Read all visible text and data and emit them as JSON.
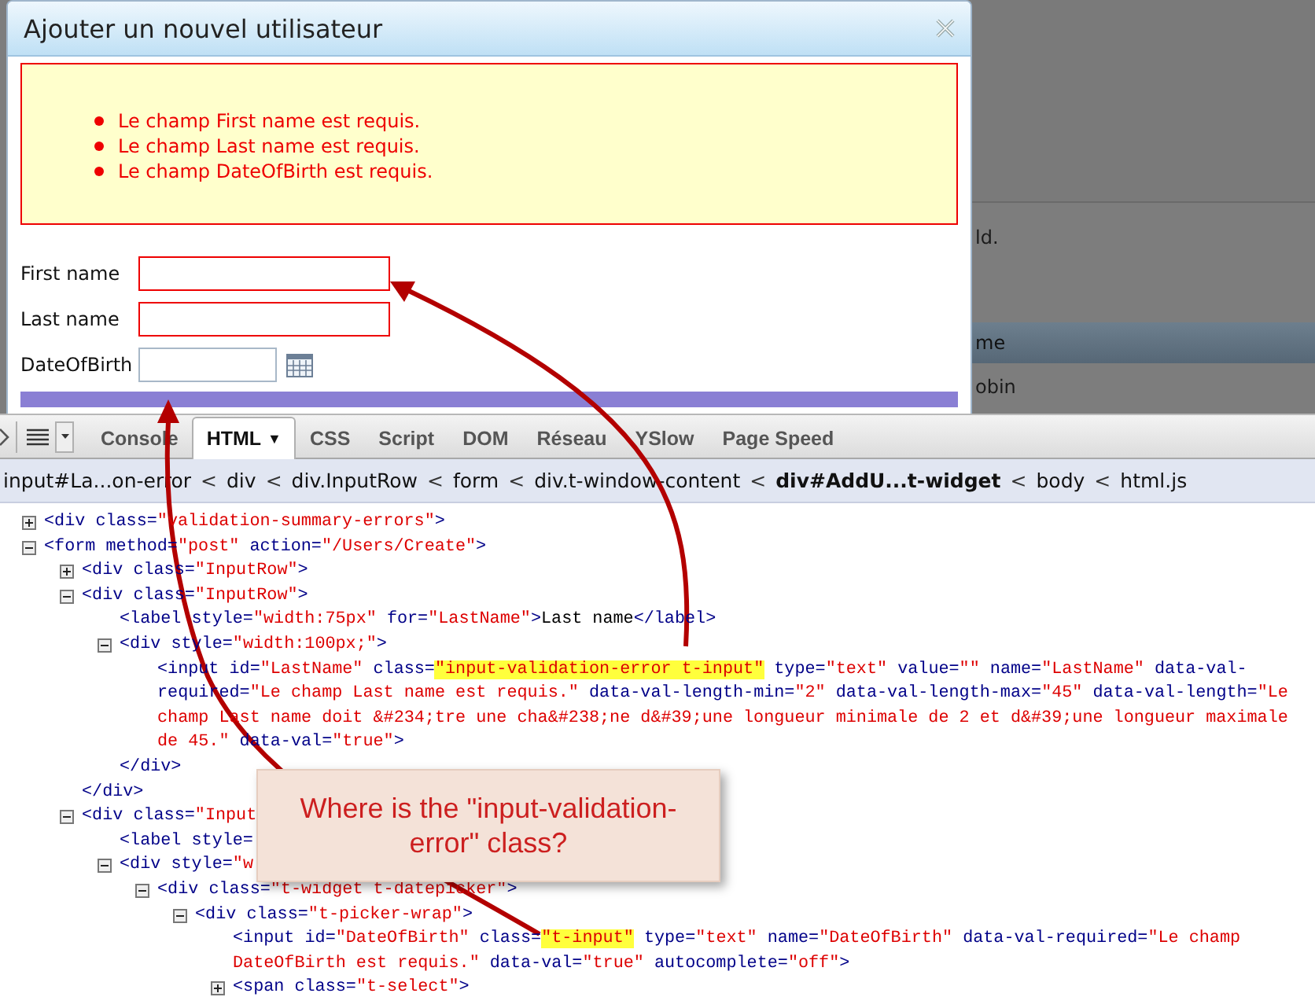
{
  "dialog": {
    "title": "Ajouter un nouvel utilisateur",
    "errors": [
      "Le champ First name est requis.",
      "Le champ Last name est requis.",
      "Le champ DateOfBirth est requis."
    ],
    "fields": [
      {
        "label": "First name",
        "kind": "text",
        "error": true
      },
      {
        "label": "Last name",
        "kind": "text",
        "error": true
      },
      {
        "label": "DateOfBirth",
        "kind": "date",
        "error": false
      }
    ]
  },
  "background_page": {
    "note": "ld.",
    "table_header": "me",
    "table_cell": "obin"
  },
  "firebug": {
    "tabs": [
      {
        "label": "Console",
        "selected": false
      },
      {
        "label": "HTML",
        "selected": true,
        "glyph": "▼"
      },
      {
        "label": "CSS",
        "selected": false
      },
      {
        "label": "Script",
        "selected": false
      },
      {
        "label": "DOM",
        "selected": false
      },
      {
        "label": "Réseau",
        "selected": false
      },
      {
        "label": "YSlow",
        "selected": false
      },
      {
        "label": "Page Speed",
        "selected": false
      }
    ],
    "breadcrumb": [
      {
        "kind": "crumb",
        "label": "input#La...on-error",
        "selected": false
      },
      {
        "kind": "separator",
        "label": "<"
      },
      {
        "kind": "crumb",
        "label": "div",
        "selected": false
      },
      {
        "kind": "separator",
        "label": "<"
      },
      {
        "kind": "crumb",
        "label": "div.InputRow",
        "selected": false
      },
      {
        "kind": "separator",
        "label": "<"
      },
      {
        "kind": "crumb",
        "label": "form",
        "selected": false
      },
      {
        "kind": "separator",
        "label": "<"
      },
      {
        "kind": "crumb",
        "label": "div.t-window-content",
        "selected": false
      },
      {
        "kind": "separator",
        "label": "<"
      },
      {
        "kind": "crumb",
        "label": "div#AddU...t-widget",
        "selected": true
      },
      {
        "kind": "separator",
        "label": "<"
      },
      {
        "kind": "crumb",
        "label": "body",
        "selected": false
      },
      {
        "kind": "separator",
        "label": "<"
      },
      {
        "kind": "crumb",
        "label": "html.js",
        "selected": false
      }
    ]
  },
  "html_tree": [
    {
      "kind": "element",
      "expanded": false,
      "segments": [
        {
          "kind": "tag",
          "text": "<div "
        },
        {
          "kind": "attr",
          "text": "class="
        },
        {
          "kind": "value",
          "text": "\"validation-summary-errors\""
        },
        {
          "kind": "tag",
          "text": ">"
        }
      ]
    },
    {
      "kind": "element",
      "expanded": true,
      "segments": [
        {
          "kind": "tag",
          "text": "<form "
        },
        {
          "kind": "attr",
          "text": "method="
        },
        {
          "kind": "value",
          "text": "\"post\""
        },
        {
          "kind": "attr",
          "text": " action="
        },
        {
          "kind": "value",
          "text": "\"/Users/Create\""
        },
        {
          "kind": "tag",
          "text": ">"
        }
      ],
      "children": [
        {
          "kind": "element",
          "expanded": false,
          "segments": [
            {
              "kind": "tag",
              "text": "<div "
            },
            {
              "kind": "attr",
              "text": "class="
            },
            {
              "kind": "value",
              "text": "\"InputRow\""
            },
            {
              "kind": "tag",
              "text": ">"
            }
          ]
        },
        {
          "kind": "element",
          "expanded": true,
          "segments": [
            {
              "kind": "tag",
              "text": "<div "
            },
            {
              "kind": "attr",
              "text": "class="
            },
            {
              "kind": "value",
              "text": "\"InputRow\""
            },
            {
              "kind": "tag",
              "text": ">"
            }
          ],
          "children": [
            {
              "kind": "leaf",
              "segments": [
                {
                  "kind": "tag",
                  "text": "<label "
                },
                {
                  "kind": "attr",
                  "text": "style="
                },
                {
                  "kind": "value",
                  "text": "\"width:75px\""
                },
                {
                  "kind": "attr",
                  "text": " for="
                },
                {
                  "kind": "value",
                  "text": "\"LastName\""
                },
                {
                  "kind": "tag",
                  "text": ">"
                },
                {
                  "kind": "text",
                  "text": "Last name"
                },
                {
                  "kind": "tag",
                  "text": "</label>"
                }
              ]
            },
            {
              "kind": "element",
              "expanded": true,
              "segments": [
                {
                  "kind": "tag",
                  "text": "<div "
                },
                {
                  "kind": "attr",
                  "text": "style="
                },
                {
                  "kind": "value",
                  "text": "\"width:100px;\""
                },
                {
                  "kind": "tag",
                  "text": ">"
                }
              ],
              "children": [
                {
                  "kind": "leaf",
                  "segments": [
                    {
                      "kind": "tag",
                      "text": "<input "
                    },
                    {
                      "kind": "attr",
                      "text": "id="
                    },
                    {
                      "kind": "value",
                      "text": "\"LastName\""
                    },
                    {
                      "kind": "attr",
                      "text": " class="
                    },
                    {
                      "kind": "highlight",
                      "text": "\"input-validation-error t-input\""
                    },
                    {
                      "kind": "attr",
                      "text": " type="
                    },
                    {
                      "kind": "value",
                      "text": "\"text\""
                    },
                    {
                      "kind": "attr",
                      "text": " value="
                    },
                    {
                      "kind": "value",
                      "text": "\"\""
                    },
                    {
                      "kind": "attr",
                      "text": " name="
                    },
                    {
                      "kind": "value",
                      "text": "\"LastName\""
                    },
                    {
                      "kind": "attr",
                      "text": " data-val-required="
                    },
                    {
                      "kind": "value",
                      "text": "\"Le champ Last name est requis.\""
                    },
                    {
                      "kind": "attr",
                      "text": " data-val-length-min="
                    },
                    {
                      "kind": "value",
                      "text": "\"2\""
                    },
                    {
                      "kind": "attr",
                      "text": " data-val-length-max="
                    },
                    {
                      "kind": "value",
                      "text": "\"45\""
                    },
                    {
                      "kind": "attr",
                      "text": " data-val-length="
                    },
                    {
                      "kind": "value",
                      "text": "\"Le champ Last name doit &#234;tre une cha&#238;ne d&#39;une longueur minimale de 2 et d&#39;une longueur maximale de 45.\""
                    },
                    {
                      "kind": "attr",
                      "text": " data-val="
                    },
                    {
                      "kind": "value",
                      "text": "\"true\""
                    },
                    {
                      "kind": "tag",
                      "text": ">"
                    }
                  ]
                }
              ],
              "closing": "</div>"
            }
          ],
          "closing": "</div>"
        },
        {
          "kind": "element",
          "expanded": true,
          "segments": [
            {
              "kind": "tag",
              "text": "<div "
            },
            {
              "kind": "attr",
              "text": "class="
            },
            {
              "kind": "value",
              "text": "\"Input"
            }
          ],
          "children": [
            {
              "kind": "leaf",
              "segments": [
                {
                  "kind": "tag",
                  "text": "<label "
                },
                {
                  "kind": "attr",
                  "text": "style="
                }
              ]
            },
            {
              "kind": "element",
              "expanded": true,
              "segments": [
                {
                  "kind": "tag",
                  "text": "<div "
                },
                {
                  "kind": "attr",
                  "text": "style="
                },
                {
                  "kind": "value",
                  "text": "\"w"
                }
              ],
              "children": [
                {
                  "kind": "element",
                  "expanded": true,
                  "segments": [
                    {
                      "kind": "tag",
                      "text": "<div "
                    },
                    {
                      "kind": "attr",
                      "text": "class="
                    },
                    {
                      "kind": "value",
                      "text": "\"t-widget t-datepicker\""
                    },
                    {
                      "kind": "tag",
                      "text": ">"
                    }
                  ],
                  "children": [
                    {
                      "kind": "element",
                      "expanded": true,
                      "segments": [
                        {
                          "kind": "tag",
                          "text": "<div "
                        },
                        {
                          "kind": "attr",
                          "text": "class="
                        },
                        {
                          "kind": "value",
                          "text": "\"t-picker-wrap\""
                        },
                        {
                          "kind": "tag",
                          "text": ">"
                        }
                      ],
                      "children": [
                        {
                          "kind": "leaf",
                          "segments": [
                            {
                              "kind": "tag",
                              "text": "<input "
                            },
                            {
                              "kind": "attr",
                              "text": "id="
                            },
                            {
                              "kind": "value",
                              "text": "\"DateOfBirth\""
                            },
                            {
                              "kind": "attr",
                              "text": " class="
                            },
                            {
                              "kind": "highlight",
                              "text": "\"t-input\""
                            },
                            {
                              "kind": "attr",
                              "text": " type="
                            },
                            {
                              "kind": "value",
                              "text": "\"text\""
                            },
                            {
                              "kind": "attr",
                              "text": " name="
                            },
                            {
                              "kind": "value",
                              "text": "\"DateOfBirth\""
                            },
                            {
                              "kind": "attr",
                              "text": " data-val-required="
                            },
                            {
                              "kind": "value",
                              "text": "\"Le champ DateOfBirth est requis.\""
                            },
                            {
                              "kind": "attr",
                              "text": " data-val="
                            },
                            {
                              "kind": "value",
                              "text": "\"true\""
                            },
                            {
                              "kind": "attr",
                              "text": " autocomplete="
                            },
                            {
                              "kind": "value",
                              "text": "\"off\""
                            },
                            {
                              "kind": "tag",
                              "text": ">"
                            }
                          ]
                        },
                        {
                          "kind": "element",
                          "expanded": false,
                          "segments": [
                            {
                              "kind": "tag",
                              "text": "<span "
                            },
                            {
                              "kind": "attr",
                              "text": "class="
                            },
                            {
                              "kind": "value",
                              "text": "\"t-select\""
                            },
                            {
                              "kind": "tag",
                              "text": ">"
                            }
                          ]
                        }
                      ]
                    }
                  ]
                }
              ]
            }
          ]
        }
      ]
    }
  ],
  "callout": {
    "text": "Where is the \"input-validation-error\" class?"
  }
}
